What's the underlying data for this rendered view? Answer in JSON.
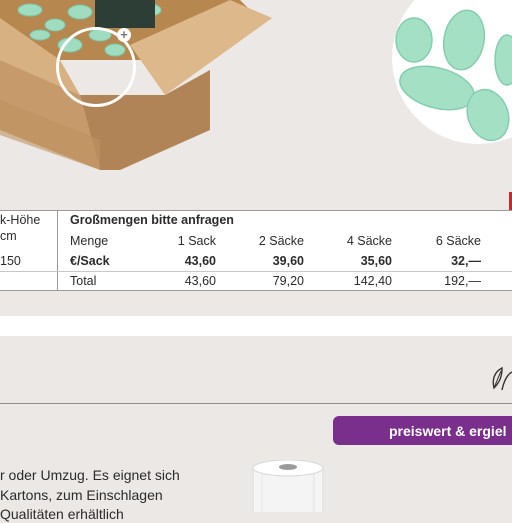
{
  "table": {
    "left_header": [
      "k-Höhe",
      "cm"
    ],
    "left_value": "150",
    "title": "Großmengen bitte anfragen",
    "header_row": [
      "Menge",
      "1 Sack",
      "2 Säcke",
      "4 Säcke",
      "6 Säcke"
    ],
    "price_row": [
      "€/Sack",
      "43,60",
      "39,60",
      "35,60",
      "32,—"
    ],
    "total_row": [
      "Total",
      "43,60",
      "79,20",
      "142,40",
      "192,—"
    ]
  },
  "promo_badge": "preiswert & ergiel",
  "description_lines": [
    "r oder Umzug. Es eignet sich",
    "Kartons, zum Einschlagen",
    "Qualitäten erhältlich"
  ],
  "icons": {
    "zoom_badge": "zoom-plus-icon",
    "leaf": "leaf-icon"
  },
  "colors": {
    "background": "#ebe8e5",
    "table_bg": "#ffffff",
    "badge_purple": "#7a2f8c",
    "red_tab": "#c8282e",
    "box": "#c69a6a",
    "peanut": "#9fdcc0"
  }
}
